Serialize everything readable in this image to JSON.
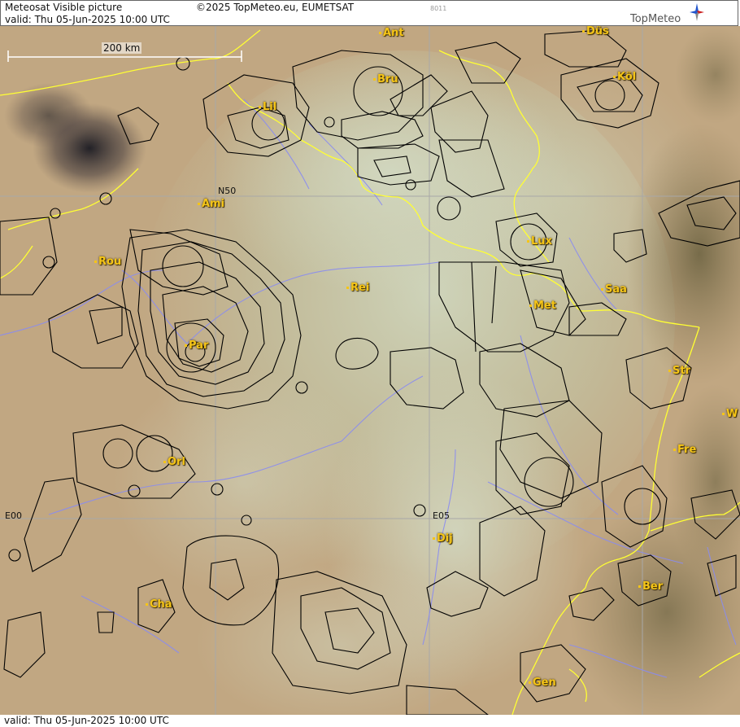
{
  "header": {
    "title": "Meteosat Visible picture",
    "copyright": "©2025 TopMeteo.eu, EUMETSAT",
    "code": "8011",
    "valid": "valid:  Thu  05-Jun-2025  10:00 UTC",
    "logo_text": "TopMeteo"
  },
  "footer": {
    "valid": "valid:  Thu  05-Jun-2025  10:00 UTC"
  },
  "map": {
    "scale_label": "200 km",
    "grid_labels": {
      "lat50": "N50",
      "lon0": "E00",
      "lon5": "E05"
    },
    "cities": [
      {
        "id": "ant",
        "label": "Ant"
      },
      {
        "id": "dus",
        "label": "Düs"
      },
      {
        "id": "bru",
        "label": "Bru"
      },
      {
        "id": "kol",
        "label": "Köl"
      },
      {
        "id": "lil",
        "label": "Lil"
      },
      {
        "id": "ami",
        "label": "Ami"
      },
      {
        "id": "lux",
        "label": "Lux"
      },
      {
        "id": "rou",
        "label": "Rou"
      },
      {
        "id": "rei",
        "label": "Rei"
      },
      {
        "id": "saa",
        "label": "Saa"
      },
      {
        "id": "met",
        "label": "Met"
      },
      {
        "id": "par",
        "label": "Par"
      },
      {
        "id": "str",
        "label": "Str"
      },
      {
        "id": "w",
        "label": "W"
      },
      {
        "id": "fre",
        "label": "Fre"
      },
      {
        "id": "orl",
        "label": "Orl"
      },
      {
        "id": "dij",
        "label": "Dij"
      },
      {
        "id": "ber",
        "label": "Ber"
      },
      {
        "id": "cha",
        "label": "Cha"
      },
      {
        "id": "gen",
        "label": "Gen"
      }
    ]
  },
  "colors": {
    "city": "#f5c518",
    "border": "#ffff33",
    "river": "#8a8cf0",
    "airspace": "#000000"
  }
}
